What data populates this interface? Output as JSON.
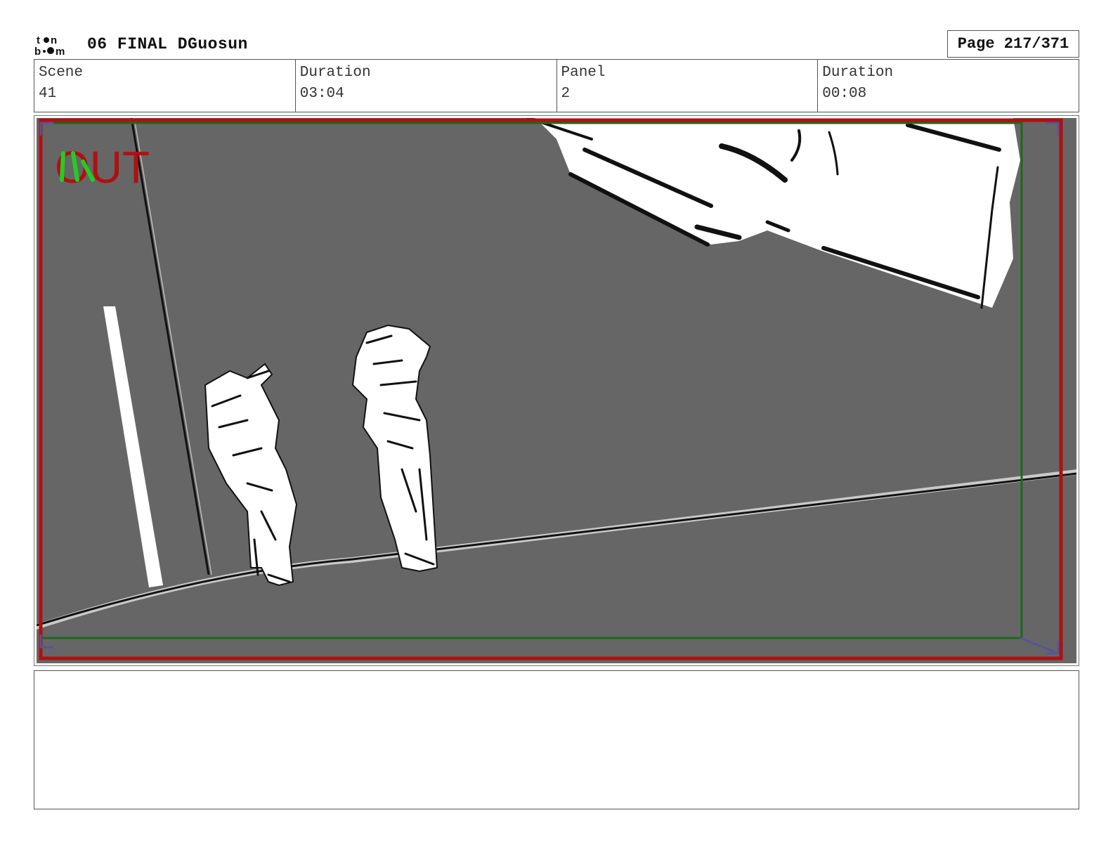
{
  "header": {
    "logo_text": "toon boom",
    "title": "06 FINAL DGuosun",
    "page": "Page 217/371"
  },
  "info": {
    "scene_label": "Scene",
    "scene_value": "41",
    "scene_duration_label": "Duration",
    "scene_duration_value": "03:04",
    "panel_label": "Panel",
    "panel_value": "2",
    "panel_duration_label": "Duration",
    "panel_duration_value": "00:08"
  },
  "panel": {
    "out_label": "OUT",
    "colors": {
      "background": "#666666",
      "safe_frame": "#b01010",
      "action_frame": "#1a6b1a",
      "sketch_fill": "#ffffff",
      "sketch_line": "#111111"
    }
  },
  "notes": {
    "text": ""
  }
}
